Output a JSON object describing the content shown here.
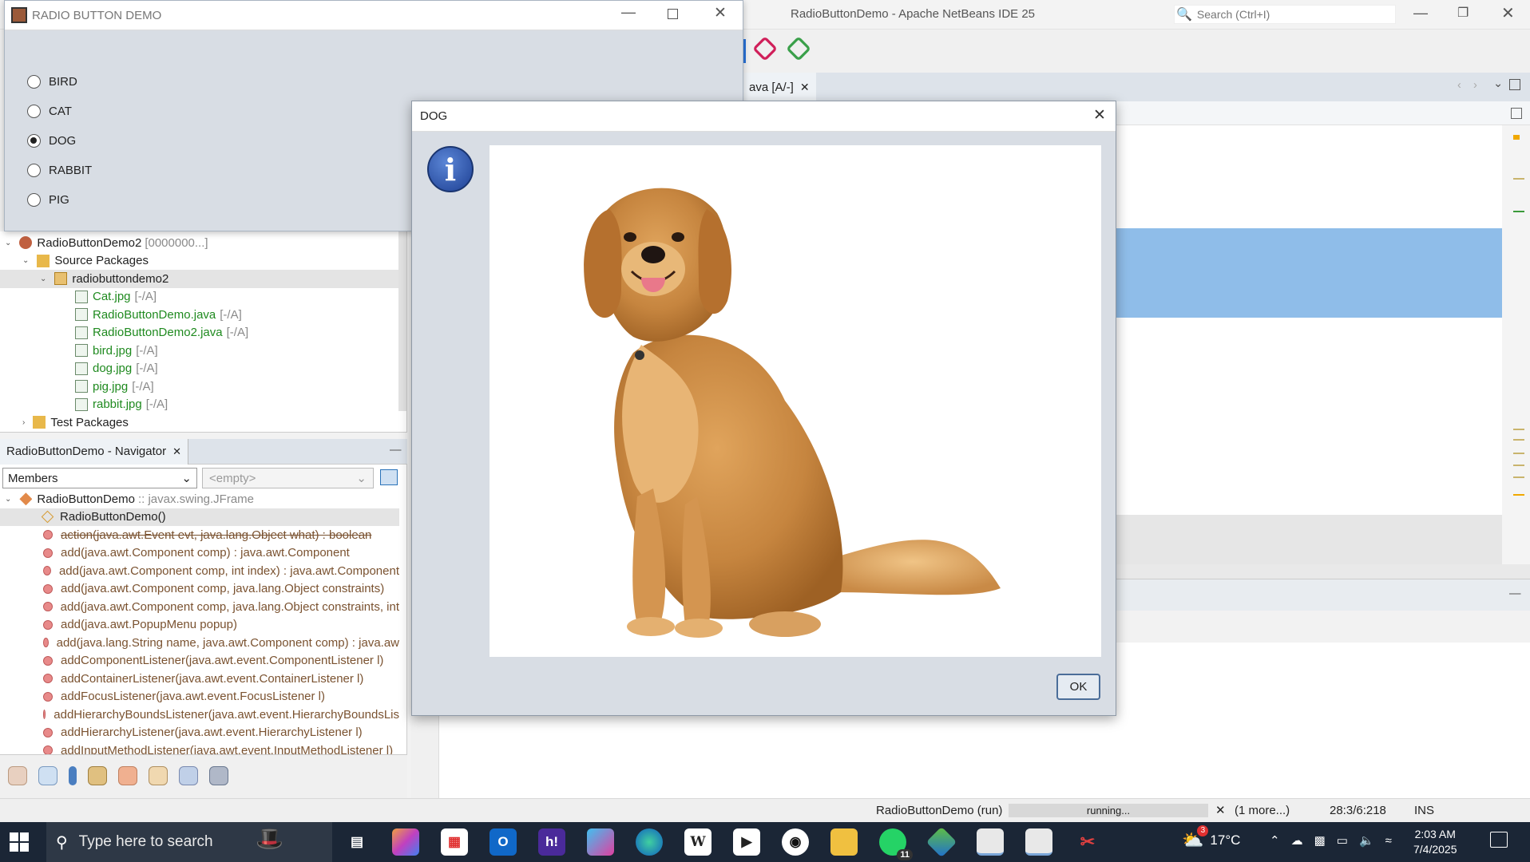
{
  "ide": {
    "title": "RadioButtonDemo - Apache NetBeans IDE 25",
    "search_placeholder": "Search (Ctrl+I)",
    "editor_tab": "ava [A/-]"
  },
  "demo_window": {
    "title": "RADIO BUTTON DEMO",
    "options": [
      {
        "label": "BIRD",
        "selected": false
      },
      {
        "label": "CAT",
        "selected": false
      },
      {
        "label": "DOG",
        "selected": true
      },
      {
        "label": "RABBIT",
        "selected": false
      },
      {
        "label": "PIG",
        "selected": false
      }
    ]
  },
  "dialog": {
    "title": "DOG",
    "ok_label": "OK",
    "info_icon": "info-icon"
  },
  "project_tree": {
    "project": "RadioButtonDemo2",
    "project_suffix": "[0000000...]",
    "source_packages": "Source Packages",
    "package": "radiobuttondemo2",
    "files": [
      {
        "name": "Cat.jpg",
        "status": "[-/A]"
      },
      {
        "name": "RadioButtonDemo.java",
        "status": "[-/A]"
      },
      {
        "name": "RadioButtonDemo2.java",
        "status": "[-/A]"
      },
      {
        "name": "bird.jpg",
        "status": "[-/A]"
      },
      {
        "name": "dog.jpg",
        "status": "[-/A]"
      },
      {
        "name": "pig.jpg",
        "status": "[-/A]"
      },
      {
        "name": "rabbit.jpg",
        "status": "[-/A]"
      }
    ],
    "test_packages": "Test Packages"
  },
  "navigator": {
    "tab": "RadioButtonDemo - Navigator",
    "filter": "Members",
    "second_filter": "<empty>",
    "class_name": "RadioButtonDemo",
    "class_type": ":: javax.swing.JFrame",
    "constructor": "RadioButtonDemo()",
    "members": [
      "action(java.awt.Event evt, java.lang.Object what) : boolean",
      "add(java.awt.Component comp) : java.awt.Component",
      "add(java.awt.Component comp, int index) : java.awt.Component",
      "add(java.awt.Component comp, java.lang.Object constraints)",
      "add(java.awt.Component comp, java.lang.Object constraints, int",
      "add(java.awt.PopupMenu popup)",
      "add(java.lang.String name, java.awt.Component comp) : java.aw",
      "addComponentListener(java.awt.event.ComponentListener l)",
      "addContainerListener(java.awt.event.ContainerListener l)",
      "addFocusListener(java.awt.event.FocusListener l)",
      "addHierarchyBoundsListener(java.awt.event.HierarchyBoundsLis",
      "addHierarchyListener(java.awt.event.HierarchyListener l)",
      "addInputMethodListener(java.awt.event.InputMethodListener l)"
    ]
  },
  "status": {
    "run": "RadioButtonDemo (run)",
    "progress_text": "running...",
    "more": "(1 more...)",
    "position": "28:3/6:218",
    "mode": "INS"
  },
  "taskbar": {
    "search_placeholder": "Type here to search",
    "weather": "17°C",
    "time": "2:03 AM",
    "date": "7/4/2025",
    "whatsapp_badge": "11",
    "weather_badge": "3"
  }
}
